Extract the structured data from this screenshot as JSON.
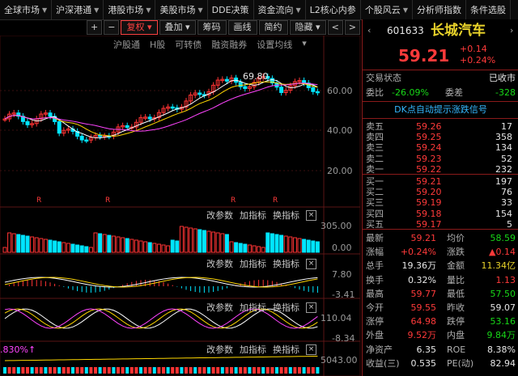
{
  "menu": [
    {
      "label": "全球市场",
      "caret": "▼"
    },
    {
      "label": "沪深港通",
      "caret": "▼"
    },
    {
      "label": "港股市场",
      "caret": "▼"
    },
    {
      "label": "美股市场",
      "caret": "▼"
    },
    {
      "label": "DDE决策",
      "caret": ""
    },
    {
      "label": "资金流向",
      "caret": "▼"
    },
    {
      "label": "L2核心内参",
      "caret": ""
    },
    {
      "label": "个股风云",
      "caret": "▼"
    },
    {
      "label": "分析师指数",
      "caret": ""
    },
    {
      "label": "条件选股",
      "caret": ""
    }
  ],
  "toolbar": {
    "plus": "+",
    "minus": "−",
    "fuquan": "复权",
    "overlay": "叠加",
    "chip": "筹码",
    "draw": "画线",
    "simple": "简约",
    "hide": "隐藏",
    "prev": "<",
    "next": ">"
  },
  "subtabs": [
    "沪股通",
    "H股",
    "可转债",
    "融资融券",
    "设置均线"
  ],
  "price_chart": {
    "y_labels": [
      "60.00",
      "40.00",
      "20.00"
    ],
    "peak_label": "69.80",
    "marks": [
      "R",
      "R",
      "R",
      "R"
    ],
    "colors": {
      "up": "#ff3333",
      "down": "#00e5ff",
      "ma1": "#ffffff",
      "ma2": "#ffd700",
      "ma3": "#ff44ff"
    }
  },
  "indicators": [
    {
      "tools": [
        "改参数",
        "加指标",
        "换指标"
      ],
      "close": "×",
      "top": "305.00",
      "mid": "0.00",
      "bottom": ""
    },
    {
      "tools": [
        "改参数",
        "加指标",
        "换指标"
      ],
      "close": "×",
      "top": "7.80",
      "mid": "",
      "bottom": "-3.41"
    },
    {
      "tools": [
        "改参数",
        "加指标",
        "换指标"
      ],
      "close": "×",
      "top": "110.04",
      "mid": "",
      "bottom": "-8.34"
    },
    {
      "tools": [
        "改参数",
        "加指标",
        "换指标"
      ],
      "close": "×",
      "top": "5043.00",
      "mid": "",
      "bottom": "",
      "left_label": ".830%↑"
    }
  ],
  "quote": {
    "code": "601633",
    "name": "长城汽车",
    "price": "59.21",
    "change": "+0.14",
    "change_pct": "+0.24%",
    "status_label": "交易状态",
    "status_value": "已收市",
    "weibi_label": "委比",
    "weibi_value": "-26.09%",
    "weicha_label": "委差",
    "weicha_value": "-328",
    "banner": "DK点自动提示涨跌信号",
    "asks": [
      {
        "label": "卖五",
        "price": "59.26",
        "vol": "17"
      },
      {
        "label": "卖四",
        "price": "59.25",
        "vol": "358"
      },
      {
        "label": "卖三",
        "price": "59.24",
        "vol": "134"
      },
      {
        "label": "卖二",
        "price": "59.23",
        "vol": "52"
      },
      {
        "label": "卖一",
        "price": "59.22",
        "vol": "232"
      }
    ],
    "bids": [
      {
        "label": "买一",
        "price": "59.21",
        "vol": "197"
      },
      {
        "label": "买二",
        "price": "59.20",
        "vol": "76"
      },
      {
        "label": "买三",
        "price": "59.19",
        "vol": "33"
      },
      {
        "label": "买四",
        "price": "59.18",
        "vol": "154"
      },
      {
        "label": "买五",
        "price": "59.17",
        "vol": "5"
      }
    ],
    "stats": [
      {
        "l1": "最新",
        "v1": "59.21",
        "c1": "red",
        "l2": "均价",
        "v2": "58.59",
        "c2": "grn"
      },
      {
        "l1": "涨幅",
        "v1": "+0.24%",
        "c1": "red",
        "l2": "涨跌",
        "v2": "▲0.14",
        "c2": "red"
      },
      {
        "l1": "总手",
        "v1": "19.36万",
        "c1": "wht",
        "l2": "金额",
        "v2": "11.34亿",
        "c2": "yel"
      },
      {
        "l1": "换手",
        "v1": "0.32%",
        "c1": "wht",
        "l2": "量比",
        "v2": "1.13",
        "c2": "red"
      },
      {
        "l1": "最高",
        "v1": "59.77",
        "c1": "red",
        "l2": "最低",
        "v2": "57.50",
        "c2": "grn"
      },
      {
        "l1": "今开",
        "v1": "59.55",
        "c1": "red",
        "l2": "昨收",
        "v2": "59.07",
        "c2": "wht"
      },
      {
        "l1": "涨停",
        "v1": "64.98",
        "c1": "red",
        "l2": "跌停",
        "v2": "53.16",
        "c2": "grn"
      },
      {
        "l1": "外盘",
        "v1": "9.52万",
        "c1": "red",
        "l2": "内盘",
        "v2": "9.84万",
        "c2": "grn"
      },
      {
        "l1": "净资产",
        "v1": "6.35",
        "c1": "wht",
        "l2": "ROE",
        "v2": "8.38%",
        "c2": "wht"
      },
      {
        "l1": "收益(三)",
        "v1": "0.535",
        "c1": "wht",
        "l2": "PE(动)",
        "v2": "82.94",
        "c2": "wht"
      }
    ]
  }
}
